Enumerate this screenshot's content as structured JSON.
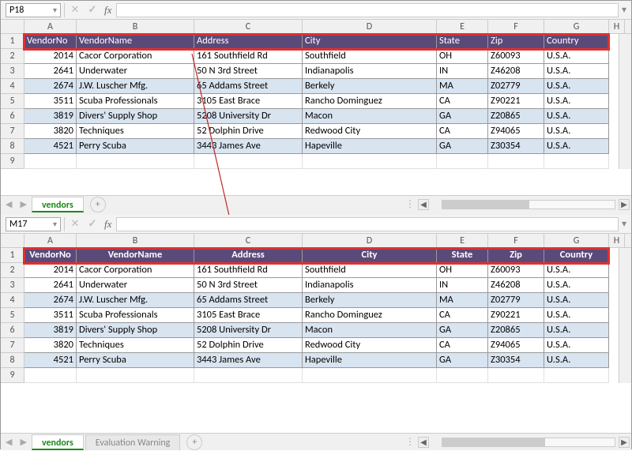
{
  "top": {
    "nameBox": "P18",
    "fxLabel": "fx",
    "tabs": {
      "active": "vendors",
      "add": "+"
    },
    "cols": [
      "A",
      "B",
      "C",
      "D",
      "E",
      "F",
      "G",
      "H"
    ],
    "header": [
      "VendorNo",
      "VendorName",
      "Address",
      "City",
      "State",
      "Zip",
      "Country"
    ],
    "rows": [
      {
        "n": "1"
      },
      {
        "n": "2",
        "cells": [
          "2014",
          "Cacor Corporation",
          "161 Southfield Rd",
          "Southfield",
          "OH",
          "Z60093",
          "U.S.A."
        ],
        "alt": false
      },
      {
        "n": "3",
        "cells": [
          "2641",
          "Underwater",
          "50 N 3rd Street",
          "Indianapolis",
          "IN",
          "Z46208",
          "U.S.A."
        ],
        "alt": false
      },
      {
        "n": "4",
        "cells": [
          "2674",
          "J.W.  Luscher Mfg.",
          "65 Addams Street",
          "Berkely",
          "MA",
          "Z02779",
          "U.S.A."
        ],
        "alt": true
      },
      {
        "n": "5",
        "cells": [
          "3511",
          "Scuba Professionals",
          "3105 East Brace",
          "Rancho Dominguez",
          "CA",
          "Z90221",
          "U.S.A."
        ],
        "alt": false
      },
      {
        "n": "6",
        "cells": [
          "3819",
          "Divers'  Supply Shop",
          "5208 University Dr",
          "Macon",
          "GA",
          "Z20865",
          "U.S.A."
        ],
        "alt": true
      },
      {
        "n": "7",
        "cells": [
          "3820",
          "Techniques",
          "52 Dolphin Drive",
          "Redwood City",
          "CA",
          "Z94065",
          "U.S.A."
        ],
        "alt": false
      },
      {
        "n": "8",
        "cells": [
          "4521",
          "Perry Scuba",
          "3443 James Ave",
          "Hapeville",
          "GA",
          "Z30354",
          "U.S.A."
        ],
        "alt": true
      },
      {
        "n": "9"
      }
    ]
  },
  "bottom": {
    "nameBox": "M17",
    "fxLabel": "fx",
    "tabs": {
      "active": "vendors",
      "other": "Evaluation Warning",
      "add": "+"
    },
    "cols": [
      "A",
      "B",
      "C",
      "D",
      "E",
      "F",
      "G",
      "H"
    ],
    "header": [
      "VendorNo",
      "VendorName",
      "Address",
      "City",
      "State",
      "Zip",
      "Country"
    ],
    "rows": [
      {
        "n": "1"
      },
      {
        "n": "2",
        "cells": [
          "2014",
          "Cacor Corporation",
          "161 Southfield Rd",
          "Southfield",
          "OH",
          "Z60093",
          "U.S.A."
        ],
        "alt": false
      },
      {
        "n": "3",
        "cells": [
          "2641",
          "Underwater",
          "50 N 3rd Street",
          "Indianapolis",
          "IN",
          "Z46208",
          "U.S.A."
        ],
        "alt": false
      },
      {
        "n": "4",
        "cells": [
          "2674",
          "J.W.  Luscher Mfg.",
          "65 Addams Street",
          "Berkely",
          "MA",
          "Z02779",
          "U.S.A."
        ],
        "alt": true
      },
      {
        "n": "5",
        "cells": [
          "3511",
          "Scuba Professionals",
          "3105 East Brace",
          "Rancho Dominguez",
          "CA",
          "Z90221",
          "U.S.A."
        ],
        "alt": false
      },
      {
        "n": "6",
        "cells": [
          "3819",
          "Divers'  Supply Shop",
          "5208 University Dr",
          "Macon",
          "GA",
          "Z20865",
          "U.S.A."
        ],
        "alt": true
      },
      {
        "n": "7",
        "cells": [
          "3820",
          "Techniques",
          "52 Dolphin Drive",
          "Redwood City",
          "CA",
          "Z94065",
          "U.S.A."
        ],
        "alt": false
      },
      {
        "n": "8",
        "cells": [
          "4521",
          "Perry Scuba",
          "3443 James Ave",
          "Hapeville",
          "GA",
          "Z30354",
          "U.S.A."
        ],
        "alt": true
      },
      {
        "n": "9"
      }
    ]
  }
}
